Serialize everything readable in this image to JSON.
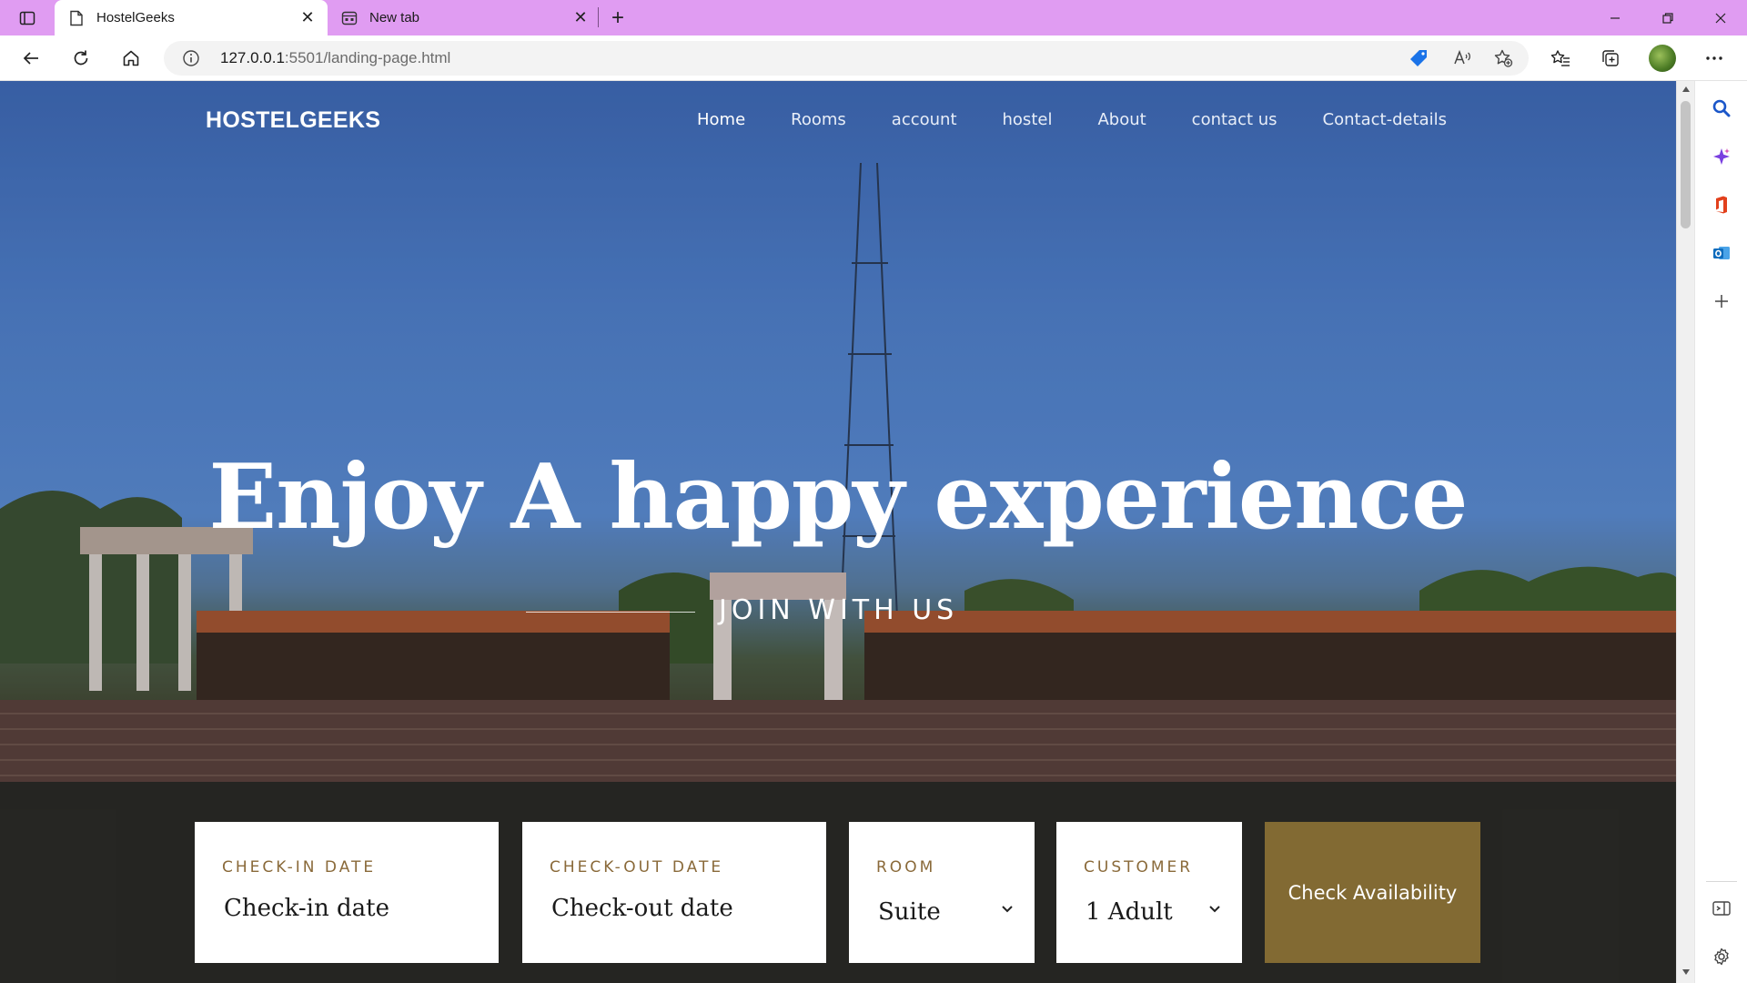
{
  "browser": {
    "tabs": [
      {
        "title": "HostelGeeks",
        "active": true,
        "icon": "page-icon"
      },
      {
        "title": "New tab",
        "active": false,
        "icon": "new-tab-page-icon"
      }
    ],
    "close_glyph": "✕",
    "new_tab_glyph": "+",
    "address": {
      "host": "127.0.0.1",
      "rest": ":5501/landing-page.html"
    },
    "colors": {
      "tabstrip": "#e09cf2",
      "accent_brown": "#826a33",
      "label_brown": "#8a6a3a"
    }
  },
  "site": {
    "logo": "HOSTELGEEKS",
    "nav": [
      {
        "label": "Home",
        "active": true
      },
      {
        "label": "Rooms",
        "active": false
      },
      {
        "label": "account",
        "active": false
      },
      {
        "label": "hostel",
        "active": false
      },
      {
        "label": "About",
        "active": false
      },
      {
        "label": "contact us",
        "active": false
      },
      {
        "label": "Contact-details",
        "active": false
      }
    ],
    "hero": {
      "title": "Enjoy A happy experience",
      "subtitle": "JOIN WITH US"
    },
    "booking": {
      "checkin": {
        "label": "CHECK-IN DATE",
        "placeholder": "Check-in date"
      },
      "checkout": {
        "label": "CHECK-OUT DATE",
        "placeholder": "Check-out date"
      },
      "room": {
        "label": "ROOM",
        "value": "Suite"
      },
      "customer": {
        "label": "CUSTOMER",
        "value": "1 Adult"
      },
      "button": "Check Availability"
    }
  }
}
